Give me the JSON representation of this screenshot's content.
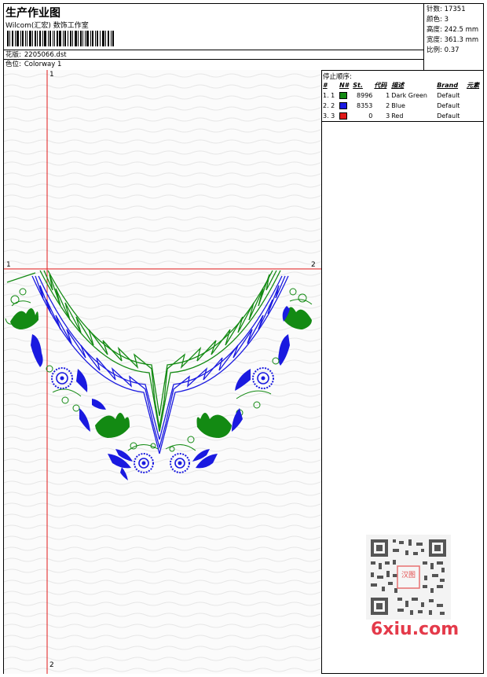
{
  "header": {
    "title": "生产作业图",
    "studio": "Wilcom(汇宏) 数饰工作室",
    "design_label": "花版:",
    "design_value": "2205066.dst",
    "colorway_label": "色位:",
    "colorway_value": "Colorway 1"
  },
  "stats": {
    "stitches_label": "针数:",
    "stitches": "17351",
    "colors_label": "颜色:",
    "colors": "3",
    "height_label": "高度:",
    "height": "242.5 mm",
    "width_label": "宽度:",
    "width": "361.3 mm",
    "scale_label": "比例:",
    "scale": "0.37"
  },
  "stop_sequence": {
    "title": "停止顺序:",
    "columns": [
      "#",
      "N#",
      "St.",
      "代码",
      "描述",
      "Brand",
      "元素"
    ],
    "rows": [
      {
        "index": "1. 1",
        "color": "#138a13",
        "stitches": "8996",
        "code": "1",
        "desc": "Dark Green",
        "brand": "Default"
      },
      {
        "index": "2. 2",
        "color": "#1a1ae0",
        "stitches": "8353",
        "code": "2",
        "desc": "Blue",
        "brand": "Default"
      },
      {
        "index": "3. 3",
        "color": "#e01a1a",
        "stitches": "0",
        "code": "3",
        "desc": "Red",
        "brand": "Default"
      }
    ]
  },
  "guides": {
    "v_top": "1",
    "v_bottom": "2",
    "h_left": "1",
    "h_right": "2"
  },
  "watermark": {
    "brand": "6xiu.com",
    "seal_text": "汉图"
  },
  "colors": {
    "green": "#138a13",
    "blue": "#1a1ae0",
    "red": "#e01a1a",
    "guide": "#e01a1a"
  }
}
